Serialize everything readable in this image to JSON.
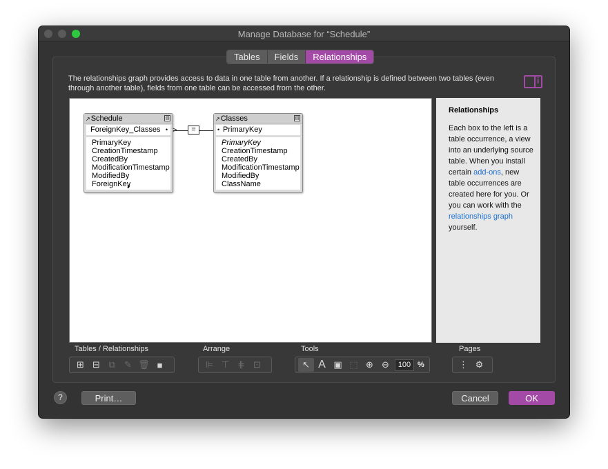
{
  "window": {
    "title": "Manage Database for “Schedule”"
  },
  "tabs": [
    {
      "label": "Tables",
      "active": false
    },
    {
      "label": "Fields",
      "active": false
    },
    {
      "label": "Relationships",
      "active": true
    }
  ],
  "intro": "The relationships graph provides access to data in one table from another. If a relationship is defined between two tables (even through another table), fields from one table can be accessed from the other.",
  "graph": {
    "tables": [
      {
        "name": "Schedule",
        "key_field": "ForeignKey_Classes",
        "fields": [
          "PrimaryKey",
          "CreationTimestamp",
          "CreatedBy",
          "ModificationTimestamp",
          "ModifiedBy",
          "ForeignKey"
        ]
      },
      {
        "name": "Classes",
        "key_field": "PrimaryKey",
        "fields": [
          "PrimaryKey",
          "CreationTimestamp",
          "CreatedBy",
          "ModificationTimestamp",
          "ModifiedBy",
          "ClassName"
        ]
      }
    ],
    "relationship_operator": "="
  },
  "sidebar": {
    "title": "Relationships",
    "text_1": "Each box to the left is a table occurrence, a view into an underlying source table. When you install certain",
    "link_1": "add-ons",
    "text_2": ", new table occurrences are created here for you. Or you can work with the",
    "link_2": "relationships graph",
    "text_3": "yourself."
  },
  "toolbar": {
    "tables_label": "Tables / Relationships",
    "arrange_label": "Arrange",
    "tools_label": "Tools",
    "pages_label": "Pages",
    "zoom": "100",
    "zoom_unit": "%"
  },
  "footer": {
    "help": "?",
    "print": "Print…",
    "cancel": "Cancel",
    "ok": "OK"
  },
  "colors": {
    "accent": "#a24aa6",
    "link": "#1a6fd1"
  }
}
